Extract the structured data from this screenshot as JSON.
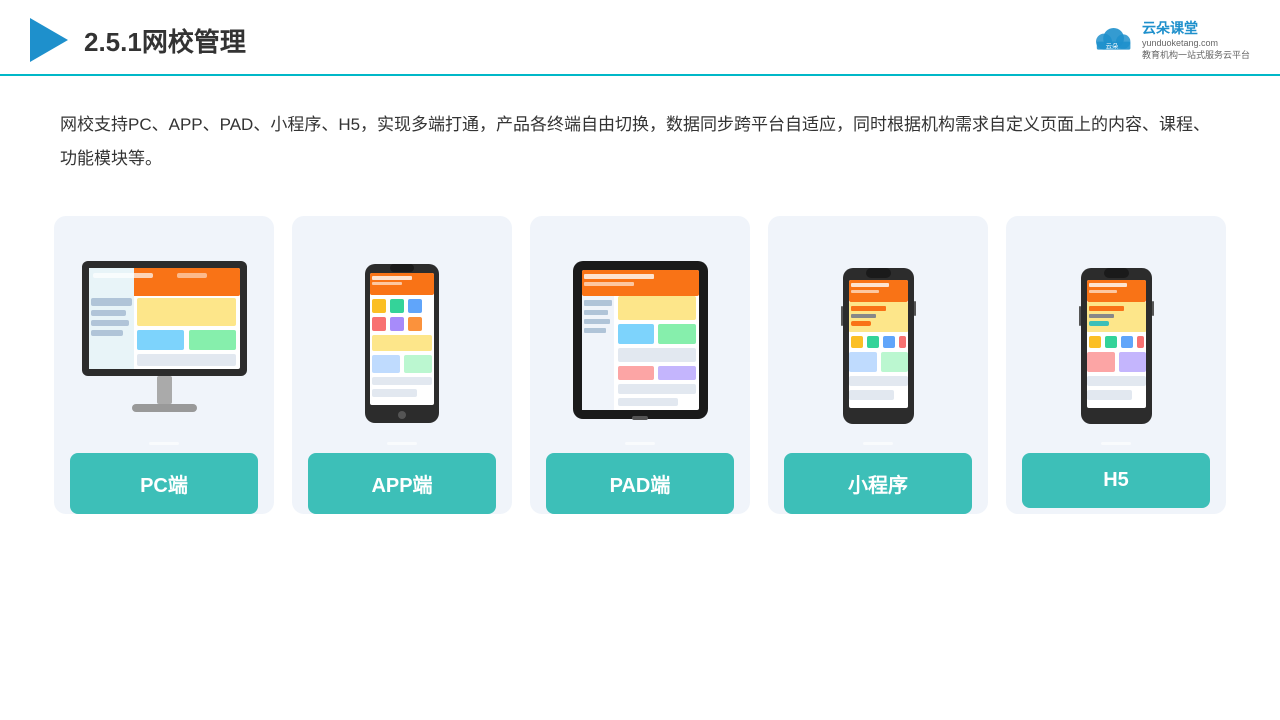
{
  "header": {
    "title": "2.5.1网校管理",
    "brand_name": "云朵课堂",
    "brand_url": "yunduoketang.com",
    "brand_tagline": "教育机构一站\n式服务云平台"
  },
  "description": "网校支持PC、APP、PAD、小程序、H5，实现多端打通，产品各终端自由切换，数据同步跨平台自适应，同时根据机构需求自定义页面上的内容、课程、功能模块等。",
  "cards": [
    {
      "id": "pc",
      "label": "PC端"
    },
    {
      "id": "app",
      "label": "APP端"
    },
    {
      "id": "pad",
      "label": "PAD端"
    },
    {
      "id": "miniapp",
      "label": "小程序"
    },
    {
      "id": "h5",
      "label": "H5"
    }
  ]
}
